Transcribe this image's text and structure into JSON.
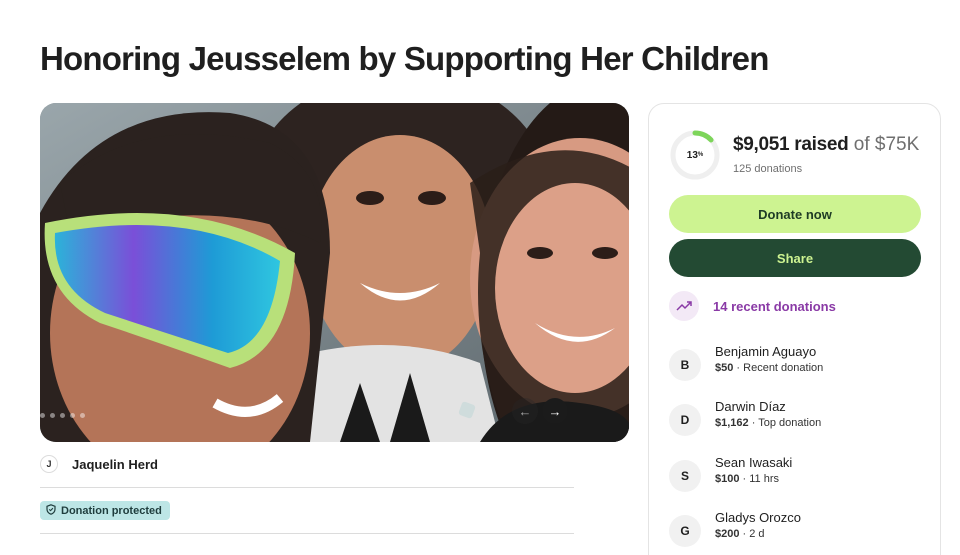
{
  "page": {
    "title": "Honoring Jeusselem by Supporting Her Children"
  },
  "gallery": {
    "slide_count": 6,
    "active_index": 0,
    "prev_icon": "arrow-left-icon",
    "next_icon": "arrow-right-icon"
  },
  "organizer": {
    "initial": "J",
    "name": "Jaquelin Herd"
  },
  "badge": {
    "icon": "shield-icon",
    "label": "Donation protected"
  },
  "summary": {
    "progress_label": "13",
    "progress_unit": "%",
    "progress_fraction": 0.13,
    "raised": "$9,051 raised",
    "goal": "of $75K",
    "donations": "125 donations"
  },
  "buttons": {
    "donate": "Donate now",
    "share": "Share"
  },
  "recent": {
    "icon": "trending-up-icon",
    "label": "14 recent donations"
  },
  "donors": [
    {
      "initial": "B",
      "name": "Benjamin Aguayo",
      "amount": "$50",
      "detail": " · Recent donation"
    },
    {
      "initial": "D",
      "name": "Darwin Díaz",
      "amount": "$1,162",
      "detail": " · Top donation"
    },
    {
      "initial": "S",
      "name": "Sean Iwasaki",
      "amount": "$100",
      "detail": " · 11 hrs"
    },
    {
      "initial": "G",
      "name": "Gladys Orozco",
      "amount": "$200",
      "detail": " · 2 d"
    }
  ],
  "colors": {
    "donate_bg": "#cdf391",
    "share_bg": "#234a33",
    "accent_purple": "#8a3aa6",
    "badge_bg": "#bde6e6",
    "progress_green": "#7dd55a"
  }
}
